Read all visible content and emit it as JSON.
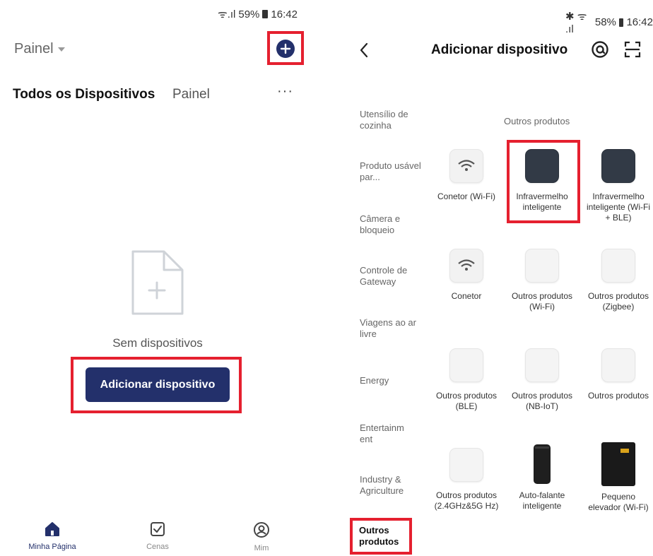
{
  "left": {
    "status": {
      "signal": "ᯤ.ıl",
      "battery": "59%",
      "time": "16:42"
    },
    "header": {
      "dropdown_label": "Painel"
    },
    "tabs": [
      {
        "label": "Todos os Dispositivos"
      },
      {
        "label": "Painel"
      }
    ],
    "more_label": "···",
    "empty": {
      "text": "Sem dispositivos",
      "button": "Adicionar dispositivo"
    },
    "nav": [
      {
        "label": "Minha Página",
        "icon": "home-icon",
        "active": true
      },
      {
        "label": "Cenas",
        "icon": "checkbox-icon"
      },
      {
        "label": "Mim",
        "icon": "user-icon"
      }
    ],
    "accent": "#23306b"
  },
  "right": {
    "status": {
      "signal": "✱ ᯤ .ıl",
      "battery": "58%",
      "time": "16:42"
    },
    "title": "Adicionar dispositivo",
    "categories": [
      "Utensílio de cozinha",
      "Produto usável par...",
      "Câmera e bloqueio",
      "Controle de Gateway",
      "Viagens ao ar livre",
      "Energy",
      "Entertainm ent",
      "Industry & Agriculture",
      "Outros produtos"
    ],
    "section_title": "Outros produtos",
    "products": [
      {
        "label": "Conetor (Wi-Fi)",
        "icon": "wifi-icon"
      },
      {
        "label": "Infravermelho inteligente",
        "icon": "ir-remote-icon"
      },
      {
        "label": "Infravermelho inteligente (Wi-Fi + BLE)",
        "icon": "ir-remote-icon"
      },
      {
        "label": "Conetor",
        "icon": "wifi-icon"
      },
      {
        "label": "Outros produtos (Wi-Fi)",
        "icon": "generic-device-icon"
      },
      {
        "label": "Outros produtos (Zigbee)",
        "icon": "generic-device-icon"
      },
      {
        "label": "Outros produtos (BLE)",
        "icon": "generic-device-icon"
      },
      {
        "label": "Outros produtos (NB-IoT)",
        "icon": "generic-device-icon"
      },
      {
        "label": "Outros produtos",
        "icon": "generic-device-icon"
      },
      {
        "label": "Outros produtos (2.4GHz&5G Hz)",
        "icon": "generic-device-icon"
      },
      {
        "label": "Auto-falante inteligente",
        "icon": "speaker-icon"
      },
      {
        "label": "Pequeno elevador (Wi-Fi)",
        "icon": "elevator-icon"
      }
    ],
    "highlight_color": "#e5202f"
  }
}
